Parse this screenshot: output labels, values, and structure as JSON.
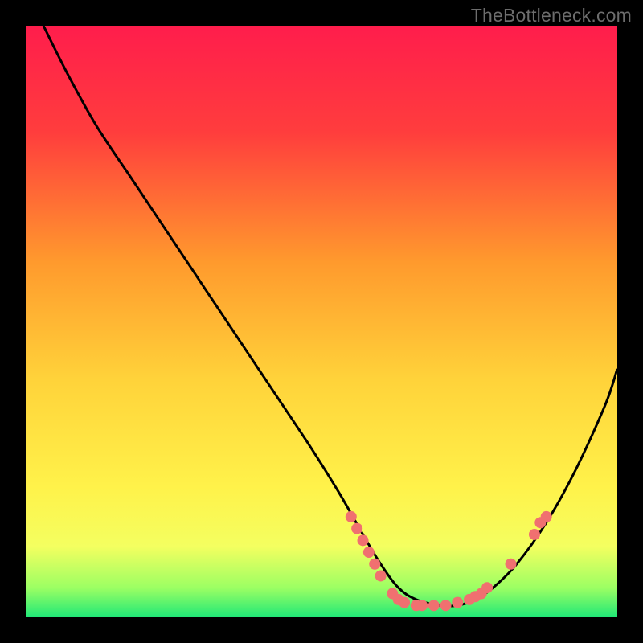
{
  "watermark": "TheBottleneck.com",
  "chart_data": {
    "type": "line",
    "title": "",
    "xlabel": "",
    "ylabel": "",
    "xlim": [
      0,
      100
    ],
    "ylim": [
      0,
      100
    ],
    "grid": false,
    "gradient_stops": [
      {
        "offset": 0,
        "color": "#ff1d4c"
      },
      {
        "offset": 18,
        "color": "#ff3d3d"
      },
      {
        "offset": 40,
        "color": "#ff9a2d"
      },
      {
        "offset": 60,
        "color": "#ffd33a"
      },
      {
        "offset": 78,
        "color": "#fff24a"
      },
      {
        "offset": 88,
        "color": "#f4ff60"
      },
      {
        "offset": 95,
        "color": "#9cff63"
      },
      {
        "offset": 100,
        "color": "#20e877"
      }
    ],
    "series": [
      {
        "name": "bottleneck-curve",
        "x": [
          3,
          7,
          12,
          18,
          24,
          30,
          36,
          42,
          48,
          53,
          57,
          60,
          63,
          66,
          70,
          73,
          76,
          79,
          83,
          88,
          93,
          98,
          100
        ],
        "values": [
          100,
          92,
          83,
          74,
          65,
          56,
          47,
          38,
          29,
          21,
          14,
          9,
          5,
          3,
          2,
          2,
          3,
          5,
          9,
          16,
          25,
          36,
          42
        ]
      }
    ],
    "markers": [
      {
        "x": 55,
        "y": 17
      },
      {
        "x": 56,
        "y": 15
      },
      {
        "x": 57,
        "y": 13
      },
      {
        "x": 58,
        "y": 11
      },
      {
        "x": 59,
        "y": 9
      },
      {
        "x": 60,
        "y": 7
      },
      {
        "x": 62,
        "y": 4
      },
      {
        "x": 63,
        "y": 3
      },
      {
        "x": 64,
        "y": 2.5
      },
      {
        "x": 66,
        "y": 2
      },
      {
        "x": 67,
        "y": 2
      },
      {
        "x": 69,
        "y": 2
      },
      {
        "x": 71,
        "y": 2
      },
      {
        "x": 73,
        "y": 2.5
      },
      {
        "x": 75,
        "y": 3
      },
      {
        "x": 76,
        "y": 3.5
      },
      {
        "x": 77,
        "y": 4
      },
      {
        "x": 78,
        "y": 5
      },
      {
        "x": 82,
        "y": 9
      },
      {
        "x": 86,
        "y": 14
      },
      {
        "x": 87,
        "y": 16
      },
      {
        "x": 88,
        "y": 17
      }
    ],
    "marker_color": "#f07070",
    "marker_radius": 7
  }
}
